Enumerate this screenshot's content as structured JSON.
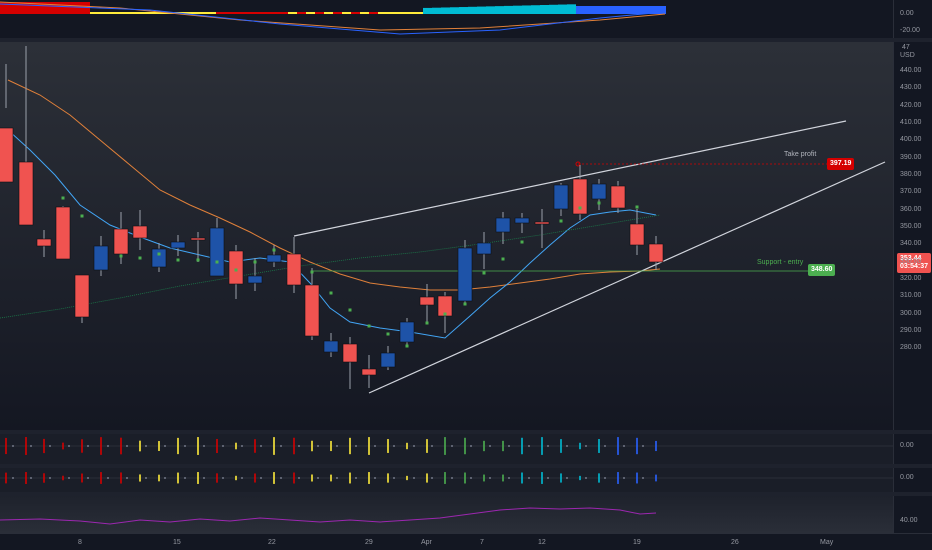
{
  "price_axis": {
    "currency": "USD",
    "top_clip_label": "47",
    "ticks": [
      "440.00",
      "430.00",
      "420.00",
      "410.00",
      "400.00",
      "390.00",
      "380.00",
      "370.00",
      "360.00",
      "350.00",
      "340.00",
      "330.00",
      "320.00",
      "310.00",
      "300.00",
      "290.00",
      "280.00"
    ],
    "last_price": "353.44",
    "countdown": "03:54:37"
  },
  "levels": {
    "target": {
      "label": "Take profit",
      "price": "397.19",
      "color": "#d50000"
    },
    "support": {
      "label": "Support - entry",
      "price": "348.60",
      "color": "#4caf50"
    }
  },
  "top_indicator": {
    "ticks": [
      "0.00",
      "-20.00"
    ]
  },
  "indicator2": {
    "ticks": [
      "0.00"
    ]
  },
  "indicator3": {
    "ticks": [
      "0.00"
    ]
  },
  "indicator4": {
    "ticks": [
      "40.00"
    ]
  },
  "time_axis": {
    "labels": [
      "8",
      "15",
      "22",
      "29",
      "Apr",
      "7",
      "12",
      "19",
      "26",
      "May"
    ]
  },
  "colors": {
    "bull": "#1e53a8",
    "bear": "#f05350",
    "ema_fast": "#42a5f5",
    "ema_slow": "#e0803a",
    "ema_long": "#1b7a4a",
    "trendline": "#d1d4dc",
    "histo_red": "#d50000",
    "histo_yellow": "#ffeb3b",
    "histo_cyan": "#00bcd4",
    "histo_blue": "#2962ff",
    "purple": "#9c27b0"
  }
}
